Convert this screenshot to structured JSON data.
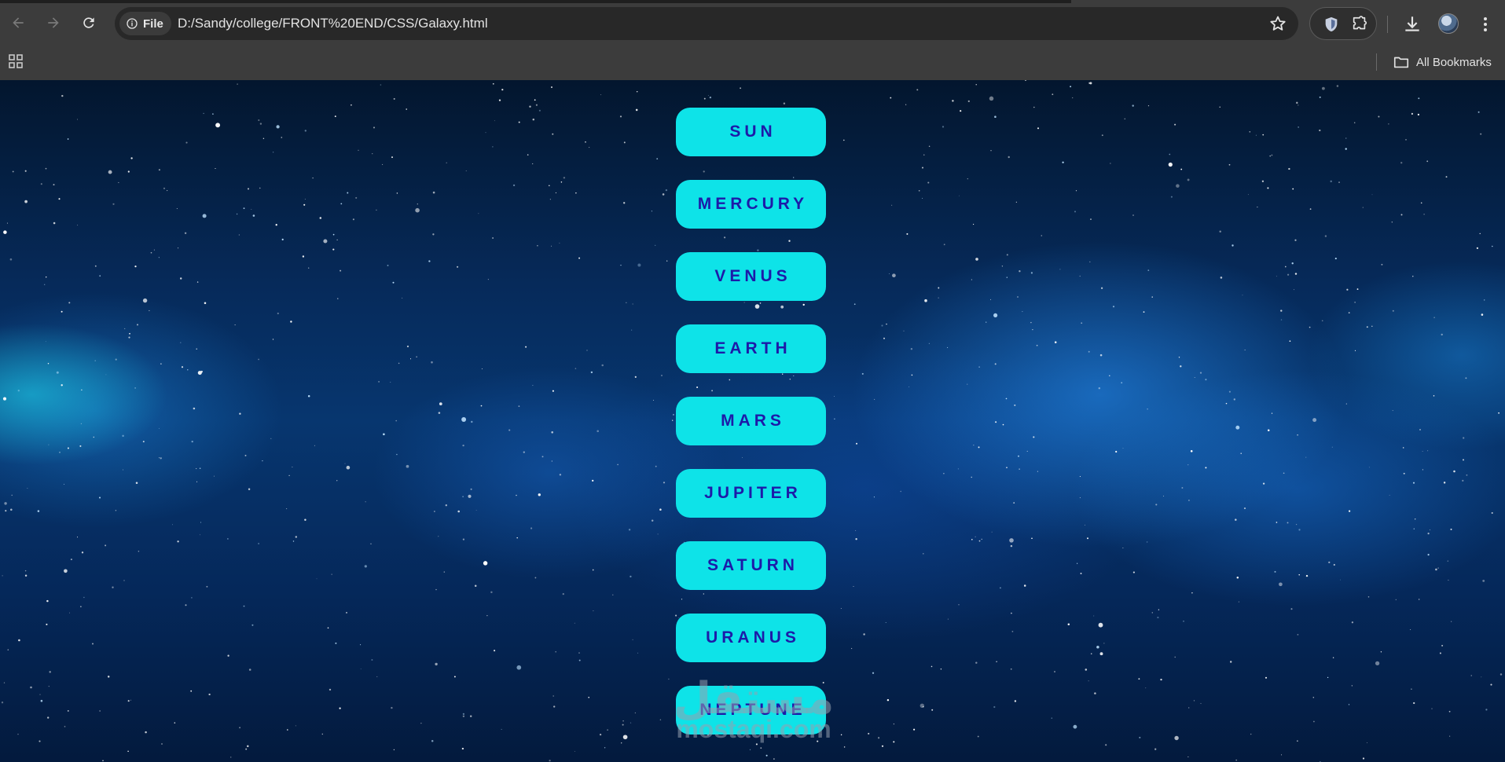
{
  "browser": {
    "site_chip_label": "File",
    "url": "D:/Sandy/college/FRONT%20END/CSS/Galaxy.html",
    "bookmarks_label": "All Bookmarks"
  },
  "icons": {
    "back": "arrow-left-icon",
    "forward": "arrow-right-icon",
    "reload": "reload-icon",
    "info": "info-icon",
    "bookmark_star": "star-icon",
    "extension_shield": "shield-icon",
    "extensions": "puzzle-icon",
    "downloads": "download-icon",
    "profile": "avatar",
    "menu": "kebab-menu-icon",
    "apps": "apps-grid-icon",
    "bookmarks_folder": "folder-icon"
  },
  "page": {
    "planets": [
      "SUN",
      "MERCURY",
      "VENUS",
      "EARTH",
      "MARS",
      "JUPITER",
      "SATURN",
      "URANUS",
      "NEPTUNE"
    ],
    "watermark_arabic": "مستقل",
    "watermark_latin": "mostaqi.com"
  },
  "colors": {
    "button_bg": "#0ee3e8",
    "button_text": "#1d1aa8",
    "chrome_bg": "#3c3c3c",
    "omnibox_bg": "#282828"
  }
}
